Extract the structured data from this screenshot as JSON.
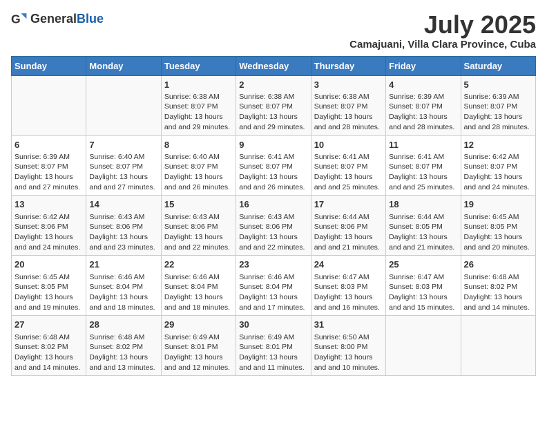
{
  "header": {
    "logo_general": "General",
    "logo_blue": "Blue",
    "month": "July 2025",
    "location": "Camajuani, Villa Clara Province, Cuba"
  },
  "days_of_week": [
    "Sunday",
    "Monday",
    "Tuesday",
    "Wednesday",
    "Thursday",
    "Friday",
    "Saturday"
  ],
  "weeks": [
    [
      {
        "day": "",
        "sunrise": "",
        "sunset": "",
        "daylight": ""
      },
      {
        "day": "",
        "sunrise": "",
        "sunset": "",
        "daylight": ""
      },
      {
        "day": "1",
        "sunrise": "Sunrise: 6:38 AM",
        "sunset": "Sunset: 8:07 PM",
        "daylight": "Daylight: 13 hours and 29 minutes."
      },
      {
        "day": "2",
        "sunrise": "Sunrise: 6:38 AM",
        "sunset": "Sunset: 8:07 PM",
        "daylight": "Daylight: 13 hours and 29 minutes."
      },
      {
        "day": "3",
        "sunrise": "Sunrise: 6:38 AM",
        "sunset": "Sunset: 8:07 PM",
        "daylight": "Daylight: 13 hours and 28 minutes."
      },
      {
        "day": "4",
        "sunrise": "Sunrise: 6:39 AM",
        "sunset": "Sunset: 8:07 PM",
        "daylight": "Daylight: 13 hours and 28 minutes."
      },
      {
        "day": "5",
        "sunrise": "Sunrise: 6:39 AM",
        "sunset": "Sunset: 8:07 PM",
        "daylight": "Daylight: 13 hours and 28 minutes."
      }
    ],
    [
      {
        "day": "6",
        "sunrise": "Sunrise: 6:39 AM",
        "sunset": "Sunset: 8:07 PM",
        "daylight": "Daylight: 13 hours and 27 minutes."
      },
      {
        "day": "7",
        "sunrise": "Sunrise: 6:40 AM",
        "sunset": "Sunset: 8:07 PM",
        "daylight": "Daylight: 13 hours and 27 minutes."
      },
      {
        "day": "8",
        "sunrise": "Sunrise: 6:40 AM",
        "sunset": "Sunset: 8:07 PM",
        "daylight": "Daylight: 13 hours and 26 minutes."
      },
      {
        "day": "9",
        "sunrise": "Sunrise: 6:41 AM",
        "sunset": "Sunset: 8:07 PM",
        "daylight": "Daylight: 13 hours and 26 minutes."
      },
      {
        "day": "10",
        "sunrise": "Sunrise: 6:41 AM",
        "sunset": "Sunset: 8:07 PM",
        "daylight": "Daylight: 13 hours and 25 minutes."
      },
      {
        "day": "11",
        "sunrise": "Sunrise: 6:41 AM",
        "sunset": "Sunset: 8:07 PM",
        "daylight": "Daylight: 13 hours and 25 minutes."
      },
      {
        "day": "12",
        "sunrise": "Sunrise: 6:42 AM",
        "sunset": "Sunset: 8:07 PM",
        "daylight": "Daylight: 13 hours and 24 minutes."
      }
    ],
    [
      {
        "day": "13",
        "sunrise": "Sunrise: 6:42 AM",
        "sunset": "Sunset: 8:06 PM",
        "daylight": "Daylight: 13 hours and 24 minutes."
      },
      {
        "day": "14",
        "sunrise": "Sunrise: 6:43 AM",
        "sunset": "Sunset: 8:06 PM",
        "daylight": "Daylight: 13 hours and 23 minutes."
      },
      {
        "day": "15",
        "sunrise": "Sunrise: 6:43 AM",
        "sunset": "Sunset: 8:06 PM",
        "daylight": "Daylight: 13 hours and 22 minutes."
      },
      {
        "day": "16",
        "sunrise": "Sunrise: 6:43 AM",
        "sunset": "Sunset: 8:06 PM",
        "daylight": "Daylight: 13 hours and 22 minutes."
      },
      {
        "day": "17",
        "sunrise": "Sunrise: 6:44 AM",
        "sunset": "Sunset: 8:06 PM",
        "daylight": "Daylight: 13 hours and 21 minutes."
      },
      {
        "day": "18",
        "sunrise": "Sunrise: 6:44 AM",
        "sunset": "Sunset: 8:05 PM",
        "daylight": "Daylight: 13 hours and 21 minutes."
      },
      {
        "day": "19",
        "sunrise": "Sunrise: 6:45 AM",
        "sunset": "Sunset: 8:05 PM",
        "daylight": "Daylight: 13 hours and 20 minutes."
      }
    ],
    [
      {
        "day": "20",
        "sunrise": "Sunrise: 6:45 AM",
        "sunset": "Sunset: 8:05 PM",
        "daylight": "Daylight: 13 hours and 19 minutes."
      },
      {
        "day": "21",
        "sunrise": "Sunrise: 6:46 AM",
        "sunset": "Sunset: 8:04 PM",
        "daylight": "Daylight: 13 hours and 18 minutes."
      },
      {
        "day": "22",
        "sunrise": "Sunrise: 6:46 AM",
        "sunset": "Sunset: 8:04 PM",
        "daylight": "Daylight: 13 hours and 18 minutes."
      },
      {
        "day": "23",
        "sunrise": "Sunrise: 6:46 AM",
        "sunset": "Sunset: 8:04 PM",
        "daylight": "Daylight: 13 hours and 17 minutes."
      },
      {
        "day": "24",
        "sunrise": "Sunrise: 6:47 AM",
        "sunset": "Sunset: 8:03 PM",
        "daylight": "Daylight: 13 hours and 16 minutes."
      },
      {
        "day": "25",
        "sunrise": "Sunrise: 6:47 AM",
        "sunset": "Sunset: 8:03 PM",
        "daylight": "Daylight: 13 hours and 15 minutes."
      },
      {
        "day": "26",
        "sunrise": "Sunrise: 6:48 AM",
        "sunset": "Sunset: 8:02 PM",
        "daylight": "Daylight: 13 hours and 14 minutes."
      }
    ],
    [
      {
        "day": "27",
        "sunrise": "Sunrise: 6:48 AM",
        "sunset": "Sunset: 8:02 PM",
        "daylight": "Daylight: 13 hours and 14 minutes."
      },
      {
        "day": "28",
        "sunrise": "Sunrise: 6:48 AM",
        "sunset": "Sunset: 8:02 PM",
        "daylight": "Daylight: 13 hours and 13 minutes."
      },
      {
        "day": "29",
        "sunrise": "Sunrise: 6:49 AM",
        "sunset": "Sunset: 8:01 PM",
        "daylight": "Daylight: 13 hours and 12 minutes."
      },
      {
        "day": "30",
        "sunrise": "Sunrise: 6:49 AM",
        "sunset": "Sunset: 8:01 PM",
        "daylight": "Daylight: 13 hours and 11 minutes."
      },
      {
        "day": "31",
        "sunrise": "Sunrise: 6:50 AM",
        "sunset": "Sunset: 8:00 PM",
        "daylight": "Daylight: 13 hours and 10 minutes."
      },
      {
        "day": "",
        "sunrise": "",
        "sunset": "",
        "daylight": ""
      },
      {
        "day": "",
        "sunrise": "",
        "sunset": "",
        "daylight": ""
      }
    ]
  ]
}
